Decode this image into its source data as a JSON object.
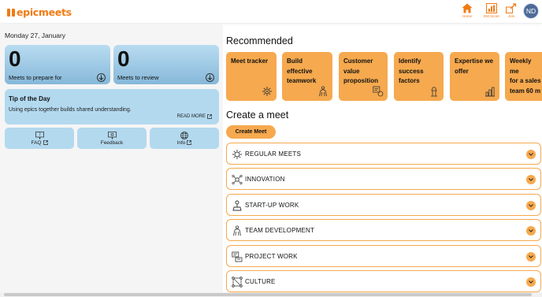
{
  "brand": {
    "logo_text": "epicmeets",
    "color": "#f07b12"
  },
  "nav": {
    "home": {
      "label": "Home",
      "icon": "home-icon"
    },
    "score": {
      "label": "EM Score",
      "icon": "score-icon"
    },
    "join": {
      "label": "Join",
      "icon": "join-icon"
    },
    "avatar_initials": "ND"
  },
  "left": {
    "date": "Monday 27, January",
    "meets_to_prepare": {
      "count": "0",
      "label": "Meets to prepare for"
    },
    "meets_to_review": {
      "count": "0",
      "label": "Meets to review"
    },
    "tip": {
      "title": "Tip of the Day",
      "text": "Using epics together builds shared understanding.",
      "read_more": "READ MORE"
    },
    "buttons": {
      "faq": "FAQ",
      "feedback": "Feedback",
      "info": "Info"
    }
  },
  "recommended": {
    "title": "Recommended",
    "cards": [
      {
        "title": "Meet tracker",
        "icon": "tracker-icon"
      },
      {
        "title": "Build\neffective\nteamwork",
        "icon": "team-icon"
      },
      {
        "title": "Customer\nvalue\nproposition",
        "icon": "value-icon"
      },
      {
        "title": "Identify\nsuccess\nfactors",
        "icon": "success-icon"
      },
      {
        "title": "Expertise we\noffer",
        "icon": "expertise-icon"
      },
      {
        "title": "Weekly me\nfor a sales\nteam 60 m",
        "icon": ""
      }
    ]
  },
  "create": {
    "title": "Create a meet",
    "button": "Create Meet",
    "categories": [
      {
        "label": "REGULAR MEETS",
        "icon": "regular-meets-icon"
      },
      {
        "label": "INNOVATION",
        "icon": "innovation-icon"
      },
      {
        "label": "START-UP WORK",
        "icon": "startup-icon"
      },
      {
        "label": "TEAM DEVELOPMENT",
        "icon": "team-development-icon"
      },
      {
        "label": "PROJECT WORK",
        "icon": "project-work-icon"
      },
      {
        "label": "CULTURE",
        "icon": "culture-icon"
      }
    ]
  },
  "colors": {
    "accent": "#f6a94e",
    "card_blue": "#b3d9ef",
    "avatar": "#4e6b99"
  }
}
